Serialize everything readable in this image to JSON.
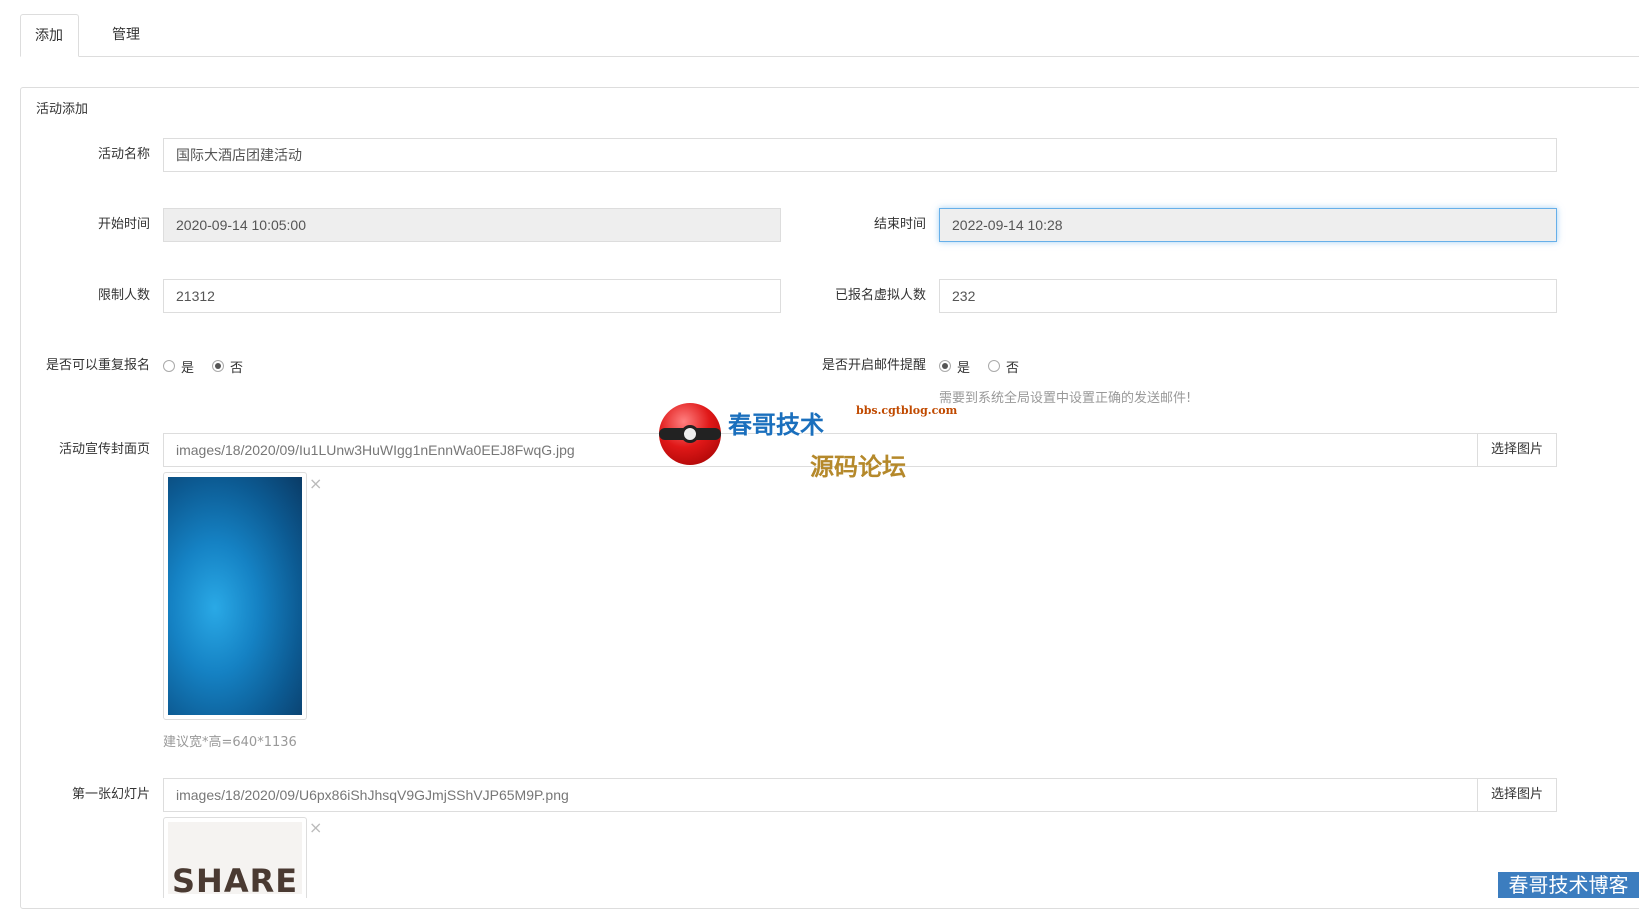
{
  "tabs": [
    {
      "label": "添加",
      "active": true
    },
    {
      "label": "管理",
      "active": false
    }
  ],
  "panel": {
    "title": "活动添加"
  },
  "form": {
    "name": {
      "label": "活动名称",
      "value": "国际大酒店团建活动"
    },
    "start_time": {
      "label": "开始时间",
      "value": "2020-09-14 10:05:00"
    },
    "end_time": {
      "label": "结束时间",
      "value": "2022-09-14 10:28"
    },
    "limit": {
      "label": "限制人数",
      "value": "21312"
    },
    "virtual_count": {
      "label": "已报名虚拟人数",
      "value": "232"
    },
    "repeat_signup": {
      "label": "是否可以重复报名",
      "options": [
        "是",
        "否"
      ],
      "selected": "否"
    },
    "email_remind": {
      "label": "是否开启邮件提醒",
      "options": [
        "是",
        "否"
      ],
      "selected": "是",
      "help": "需要到系统全局设置中设置正确的发送邮件!"
    },
    "cover": {
      "label": "活动宣传封面页",
      "value": "images/18/2020/09/Iu1LUnw3HuWIgg1nEnnWa0EEJ8FwqG.jpg",
      "button": "选择图片",
      "help": "建议宽*高=640*1136",
      "close": "×"
    },
    "slide1": {
      "label": "第一张幻灯片",
      "value": "images/18/2020/09/U6px86iShJhsqV9GJmjSShVJP65M9P.png",
      "button": "选择图片",
      "close": "×",
      "thumb_text": "SHARE"
    }
  },
  "watermark": {
    "title": "春哥技术",
    "subtitle": "源码论坛",
    "url": "bbs.cgtblog.com",
    "corner": "春哥技术博客"
  }
}
